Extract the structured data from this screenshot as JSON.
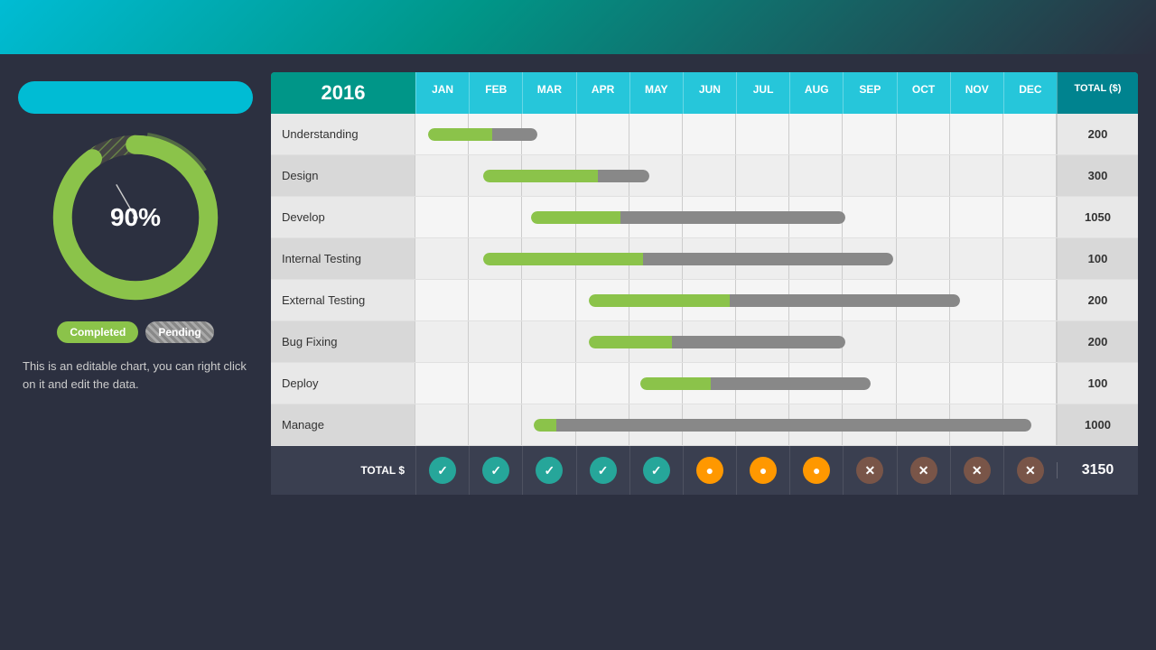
{
  "topbar": {},
  "left": {
    "title": "",
    "percentage": "90%",
    "legend": {
      "completed": "Completed",
      "pending": "Pending"
    },
    "description": "This is an editable chart, you can right click on it and edit the data."
  },
  "gantt": {
    "year": "2016",
    "months": [
      "JAN",
      "FEB",
      "MAR",
      "APR",
      "MAY",
      "JUN",
      "JUL",
      "AUG",
      "SEP",
      "OCT",
      "NOV",
      "DEC"
    ],
    "total_header": "TOTAL ($)",
    "rows": [
      {
        "label": "Understanding",
        "total": "200",
        "green_start_pct": 2,
        "green_width_pct": 10,
        "gray_start_pct": 12,
        "gray_width_pct": 8
      },
      {
        "label": "Design",
        "total": "300",
        "green_start_pct": 10,
        "green_width_pct": 18,
        "gray_start_pct": 28,
        "gray_width_pct": 8
      },
      {
        "label": "Develop",
        "total": "1050",
        "green_start_pct": 18,
        "green_width_pct": 13,
        "gray_start_pct": 31,
        "gray_width_pct": 35
      },
      {
        "label": "Internal Testing",
        "total": "100",
        "green_start_pct": 10,
        "green_width_pct": 25,
        "gray_start_pct": 35,
        "gray_width_pct": 40
      },
      {
        "label": "External Testing",
        "total": "200",
        "green_start_pct": 26,
        "green_width_pct": 22,
        "gray_start_pct": 48,
        "gray_width_pct": 38
      },
      {
        "label": "Bug Fixing",
        "total": "200",
        "green_start_pct": 26,
        "green_width_pct": 13,
        "gray_start_pct": 39,
        "gray_width_pct": 28
      },
      {
        "label": "Deploy",
        "total": "100",
        "green_start_pct": 34,
        "green_width_pct": 12,
        "gray_start_pct": 46,
        "gray_width_pct": 24
      },
      {
        "label": "Manage",
        "total": "1000",
        "green_start_pct": 18,
        "green_width_pct": 4,
        "gray_start_pct": 22,
        "gray_width_pct": 73
      }
    ],
    "footer": {
      "label": "TOTAL $",
      "statuses": [
        "check",
        "check",
        "check",
        "check",
        "check",
        "circle",
        "circle",
        "circle",
        "x",
        "x",
        "x",
        "x"
      ],
      "total": "3150"
    }
  }
}
